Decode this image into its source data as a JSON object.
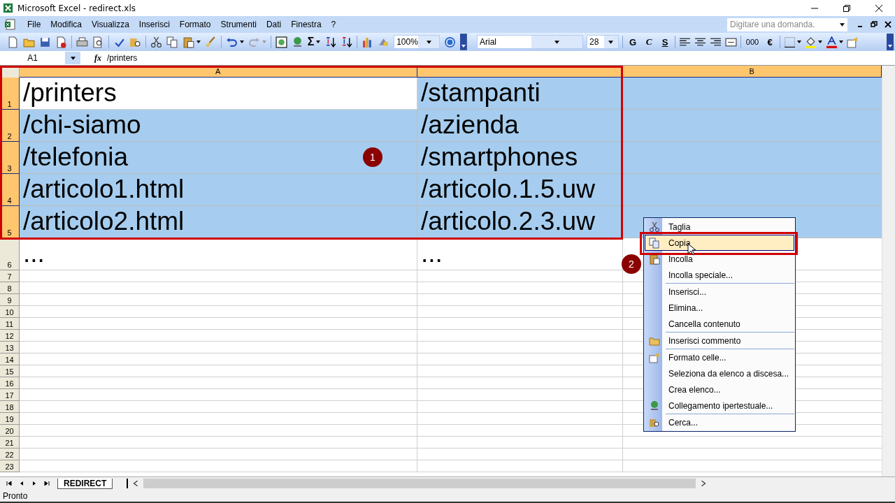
{
  "window": {
    "title": "Microsoft Excel - redirect.xls"
  },
  "menu_bar": {
    "items": [
      "File",
      "Modifica",
      "Visualizza",
      "Inserisci",
      "Formato",
      "Strumenti",
      "Dati",
      "Finestra",
      "?"
    ],
    "question_box": {
      "placeholder": "Digitare una domanda."
    }
  },
  "toolbar": {
    "sum": "Σ",
    "zoom": "100%",
    "font": "Arial",
    "font_size": "28",
    "bold": "G",
    "italic": "C",
    "underline": "S",
    "thousands": "000",
    "currency": "€"
  },
  "formula_bar": {
    "cell_ref": "A1",
    "fx": "fx",
    "value": "/printers"
  },
  "sheet": {
    "columns": [
      {
        "label": "A",
        "selected": true
      },
      {
        "selected": true
      },
      {
        "label": "B",
        "selected": true
      }
    ],
    "rows": [
      {
        "number": "1",
        "kind": "tall",
        "selected": true,
        "cells": [
          {
            "text": "/printers",
            "selected": false
          },
          {
            "text": "/stampanti",
            "selected": true
          },
          {
            "selected": true
          }
        ]
      },
      {
        "number": "2",
        "kind": "tall",
        "selected": true,
        "cells": [
          {
            "text": "/chi-siamo",
            "selected": true
          },
          {
            "text": "/azienda",
            "selected": true
          },
          {
            "selected": true
          }
        ]
      },
      {
        "number": "3",
        "kind": "tall",
        "selected": true,
        "cells": [
          {
            "text": "/telefonia",
            "selected": true
          },
          {
            "text": "/smartphones",
            "selected": true
          },
          {
            "selected": true
          }
        ]
      },
      {
        "number": "4",
        "kind": "tall",
        "selected": true,
        "cells": [
          {
            "text": "/articolo1.html",
            "selected": true
          },
          {
            "text": "/articolo.1.5.uw",
            "selected": true
          },
          {
            "selected": true
          }
        ]
      },
      {
        "number": "5",
        "kind": "tall",
        "selected": true,
        "cells": [
          {
            "text": "/articolo2.html",
            "selected": true
          },
          {
            "text": "/articolo.2.3.uw",
            "selected": true
          },
          {
            "selected": true
          }
        ]
      },
      {
        "number": "6",
        "kind": "tall",
        "selected": false,
        "cells": [
          {
            "text": "...",
            "selected": false
          },
          {
            "text": "...",
            "selected": false
          },
          {
            "selected": false
          }
        ]
      },
      {
        "number": "7",
        "kind": "short",
        "selected": false
      },
      {
        "number": "8",
        "kind": "short",
        "selected": false
      },
      {
        "number": "9",
        "kind": "short",
        "selected": false
      },
      {
        "number": "10",
        "kind": "short",
        "selected": false
      },
      {
        "number": "11",
        "kind": "short",
        "selected": false
      },
      {
        "number": "12",
        "kind": "short",
        "selected": false
      },
      {
        "number": "13",
        "kind": "short",
        "selected": false
      },
      {
        "number": "14",
        "kind": "short",
        "selected": false
      },
      {
        "number": "15",
        "kind": "short",
        "selected": false
      },
      {
        "number": "16",
        "kind": "short",
        "selected": false
      },
      {
        "number": "17",
        "kind": "short",
        "selected": false
      },
      {
        "number": "18",
        "kind": "short",
        "selected": false
      },
      {
        "number": "19",
        "kind": "short",
        "selected": false
      },
      {
        "number": "20",
        "kind": "short",
        "selected": false
      },
      {
        "number": "21",
        "kind": "short",
        "selected": false
      },
      {
        "number": "22",
        "kind": "short",
        "selected": false
      },
      {
        "number": "23",
        "kind": "short",
        "selected": false
      }
    ]
  },
  "callouts": [
    {
      "label": "1"
    },
    {
      "label": "2"
    }
  ],
  "context_menu": {
    "items": [
      {
        "label": "Taglia",
        "kind": "cut",
        "separator": false,
        "selected": false
      },
      {
        "label": "Copia",
        "kind": "copy",
        "separator": false,
        "selected": true
      },
      {
        "label": "Incolla",
        "kind": "paste",
        "separator": false,
        "selected": false
      },
      {
        "label": "Incolla speciale...",
        "kind": "plain",
        "separator": false,
        "selected": false
      },
      {
        "label": "Inserisci...",
        "kind": "plain",
        "separator": true,
        "selected": false
      },
      {
        "label": "Elimina...",
        "kind": "plain",
        "separator": false,
        "selected": false
      },
      {
        "label": "Cancella contenuto",
        "kind": "plain",
        "separator": false,
        "selected": false
      },
      {
        "label": "Inserisci commento",
        "kind": "comment",
        "separator": true,
        "selected": false
      },
      {
        "label": "Formato celle...",
        "kind": "format",
        "separator": true,
        "selected": false
      },
      {
        "label": "Seleziona da elenco a discesa...",
        "kind": "plain",
        "separator": false,
        "selected": false
      },
      {
        "label": "Crea elenco...",
        "kind": "plain",
        "separator": false,
        "selected": false
      },
      {
        "label": "Collegamento ipertestuale...",
        "kind": "link",
        "separator": false,
        "selected": false
      },
      {
        "label": "Cerca...",
        "kind": "search",
        "separator": true,
        "selected": false
      }
    ]
  },
  "sheet_tabs": [
    {
      "label": "REDIRECT",
      "selected": true
    }
  ],
  "status_bar": {
    "text": "Pronto"
  }
}
